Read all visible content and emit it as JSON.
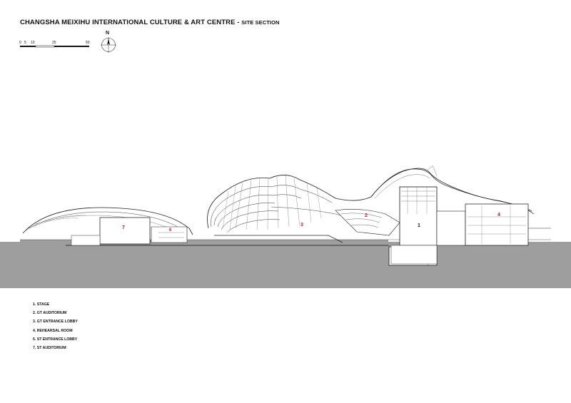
{
  "title": {
    "main": "CHANGSHA MEIXIHU INTERNATIONAL CULTURE & ART CENTRE",
    "separator": " - ",
    "sub": "SITE SECTION"
  },
  "scale_bar": {
    "labels": [
      "0",
      "5",
      "10",
      "25",
      "50"
    ]
  },
  "north_arrow": {
    "label": "N"
  },
  "room_numbers": [
    "1",
    "2",
    "3",
    "4",
    "6",
    "7"
  ],
  "legend": [
    "1. STAGE",
    "2. GT AUDITORIUM",
    "3. GT ENTRANCE LOBBY",
    "4. REHEARSAL ROOM",
    "5. ST ENTRANCE LOBBY",
    "7. ST AUDITORIUM"
  ],
  "colors": {
    "ground": "#9e9e9e",
    "section_line": "#111111",
    "room_number": "#c0202a"
  }
}
